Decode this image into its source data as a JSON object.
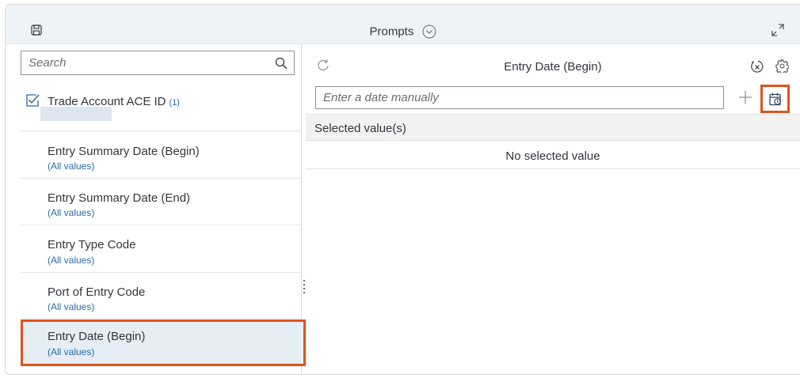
{
  "header": {
    "title": "Prompts"
  },
  "search": {
    "placeholder": "Search"
  },
  "prompts": [
    {
      "label": "Trade Account ACE ID",
      "count": "(1)",
      "checked": true
    },
    {
      "label": "Entry Summary Date (Begin)",
      "value": "(All values)"
    },
    {
      "label": "Entry Summary Date (End)",
      "value": "(All values)"
    },
    {
      "label": "Entry Type Code",
      "value": "(All values)"
    },
    {
      "label": "Port of Entry Code",
      "value": "(All values)"
    },
    {
      "label": "Entry Date (Begin)",
      "value": "(All values)",
      "selected": true
    }
  ],
  "detail": {
    "title": "Entry Date (Begin)",
    "date_placeholder": "Enter a date manually",
    "selected_header": "Selected value(s)",
    "no_value": "No selected value"
  },
  "colors": {
    "accent": "#e0531c",
    "link": "#2b6aa7",
    "header_bg": "#eef3f8",
    "selected_bg": "#e5edf5"
  },
  "icons": [
    "save-icon",
    "chevron-down-icon",
    "expand-icon",
    "search-icon",
    "checkbox-icon",
    "refresh-icon",
    "clear-selection-icon",
    "gear-icon",
    "plus-icon",
    "calendar-icon"
  ]
}
